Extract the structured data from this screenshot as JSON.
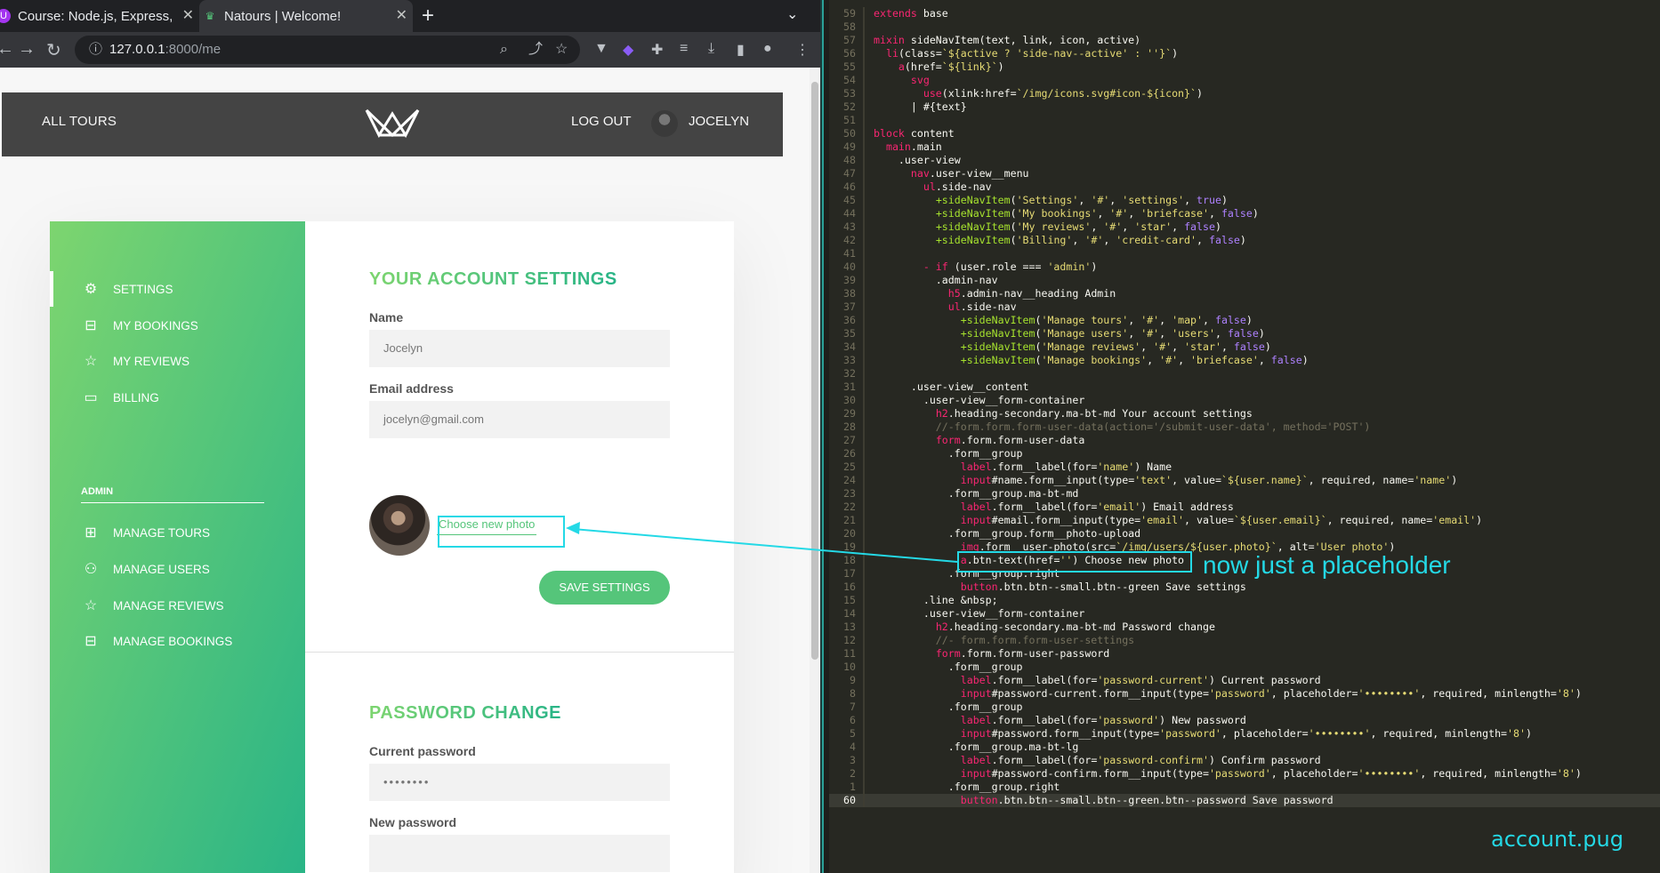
{
  "browser": {
    "tabs": [
      {
        "title": "Course: Node.js, Express,",
        "favicon": "udemy-icon"
      },
      {
        "title": "Natours | Welcome!",
        "favicon": "natours-icon"
      }
    ],
    "url_host": "127.0.0.1",
    "url_path": ":8000/me"
  },
  "site": {
    "nav_all_tours": "All tours",
    "nav_logout": "Log out",
    "user_name": "Jocelyn"
  },
  "sidebar": {
    "items": [
      {
        "label": "Settings",
        "icon": "settings-icon",
        "active": true
      },
      {
        "label": "My bookings",
        "icon": "briefcase-icon",
        "active": false
      },
      {
        "label": "My reviews",
        "icon": "star-icon",
        "active": false
      },
      {
        "label": "Billing",
        "icon": "credit-card-icon",
        "active": false
      }
    ],
    "admin_heading": "Admin",
    "admin_items": [
      {
        "label": "Manage tours",
        "icon": "map-icon"
      },
      {
        "label": "Manage users",
        "icon": "users-icon"
      },
      {
        "label": "Manage reviews",
        "icon": "star-icon"
      },
      {
        "label": "Manage bookings",
        "icon": "briefcase-icon"
      }
    ]
  },
  "settings_form": {
    "heading": "Your account settings",
    "name_label": "Name",
    "name_value": "Jocelyn",
    "email_label": "Email address",
    "email_value": "jocelyn@gmail.com",
    "choose_photo": "Choose new photo",
    "save_button": "Save settings"
  },
  "password_form": {
    "heading": "Password change",
    "current_label": "Current password",
    "current_placeholder": "••••••••",
    "new_label": "New password"
  },
  "annotation": {
    "text": "now just a placeholder"
  },
  "editor": {
    "file_label": "account.pug",
    "accent_color": "#24d9e6",
    "lines": [
      {
        "ln": "59",
        "code": "extends base"
      },
      {
        "ln": "58",
        "code": ""
      },
      {
        "ln": "57",
        "code": "mixin sideNavItem(text, link, icon, active)"
      },
      {
        "ln": "56",
        "code": "  li(class=`${active ? 'side-nav--active' : ''}`)"
      },
      {
        "ln": "55",
        "code": "    a(href=`${link}`)"
      },
      {
        "ln": "54",
        "code": "      svg"
      },
      {
        "ln": "53",
        "code": "        use(xlink:href=`/img/icons.svg#icon-${icon}`)"
      },
      {
        "ln": "52",
        "code": "      | #{text}"
      },
      {
        "ln": "51",
        "code": ""
      },
      {
        "ln": "50",
        "code": "block content"
      },
      {
        "ln": "49",
        "code": "  main.main"
      },
      {
        "ln": "48",
        "code": "    .user-view"
      },
      {
        "ln": "47",
        "code": "      nav.user-view__menu"
      },
      {
        "ln": "46",
        "code": "        ul.side-nav"
      },
      {
        "ln": "45",
        "code": "          +sideNavItem('Settings', '#', 'settings', true)"
      },
      {
        "ln": "44",
        "code": "          +sideNavItem('My bookings', '#', 'briefcase', false)"
      },
      {
        "ln": "43",
        "code": "          +sideNavItem('My reviews', '#', 'star', false)"
      },
      {
        "ln": "42",
        "code": "          +sideNavItem('Billing', '#', 'credit-card', false)"
      },
      {
        "ln": "41",
        "code": ""
      },
      {
        "ln": "40",
        "code": "        - if (user.role === 'admin')"
      },
      {
        "ln": "39",
        "code": "          .admin-nav"
      },
      {
        "ln": "38",
        "code": "            h5.admin-nav__heading Admin"
      },
      {
        "ln": "37",
        "code": "            ul.side-nav"
      },
      {
        "ln": "36",
        "code": "              +sideNavItem('Manage tours', '#', 'map', false)"
      },
      {
        "ln": "35",
        "code": "              +sideNavItem('Manage users', '#', 'users', false)"
      },
      {
        "ln": "34",
        "code": "              +sideNavItem('Manage reviews', '#', 'star', false)"
      },
      {
        "ln": "33",
        "code": "              +sideNavItem('Manage bookings', '#', 'briefcase', false)"
      },
      {
        "ln": "32",
        "code": ""
      },
      {
        "ln": "31",
        "code": "      .user-view__content"
      },
      {
        "ln": "30",
        "code": "        .user-view__form-container"
      },
      {
        "ln": "29",
        "code": "          h2.heading-secondary.ma-bt-md Your account settings"
      },
      {
        "ln": "28",
        "code": "          //-form.form.form-user-data(action='/submit-user-data', method='POST')"
      },
      {
        "ln": "27",
        "code": "          form.form.form-user-data"
      },
      {
        "ln": "26",
        "code": "            .form__group"
      },
      {
        "ln": "25",
        "code": "              label.form__label(for='name') Name"
      },
      {
        "ln": "24",
        "code": "              input#name.form__input(type='text', value=`${user.name}`, required, name='name')"
      },
      {
        "ln": "23",
        "code": "            .form__group.ma-bt-md"
      },
      {
        "ln": "22",
        "code": "              label.form__label(for='email') Email address"
      },
      {
        "ln": "21",
        "code": "              input#email.form__input(type='email', value=`${user.email}`, required, name='email')"
      },
      {
        "ln": "20",
        "code": "            .form__group.form__photo-upload"
      },
      {
        "ln": "19",
        "code": "              img.form__user-photo(src=`/img/users/${user.photo}`, alt='User photo')"
      },
      {
        "ln": "18",
        "code": "              a.btn-text(href='') Choose new photo"
      },
      {
        "ln": "17",
        "code": "            .form__group.right"
      },
      {
        "ln": "16",
        "code": "              button.btn.btn--small.btn--green Save settings"
      },
      {
        "ln": "15",
        "code": "        .line &nbsp;"
      },
      {
        "ln": "14",
        "code": "        .user-view__form-container"
      },
      {
        "ln": "13",
        "code": "          h2.heading-secondary.ma-bt-md Password change"
      },
      {
        "ln": "12",
        "code": "          //- form.form.form-user-settings"
      },
      {
        "ln": "11",
        "code": "          form.form.form-user-password"
      },
      {
        "ln": "10",
        "code": "            .form__group"
      },
      {
        "ln": "9",
        "code": "              label.form__label(for='password-current') Current password"
      },
      {
        "ln": "8",
        "code": "              input#password-current.form__input(type='password', placeholder='••••••••', required, minlength='8')"
      },
      {
        "ln": "7",
        "code": "            .form__group"
      },
      {
        "ln": "6",
        "code": "              label.form__label(for='password') New password"
      },
      {
        "ln": "5",
        "code": "              input#password.form__input(type='password', placeholder='••••••••', required, minlength='8')"
      },
      {
        "ln": "4",
        "code": "            .form__group.ma-bt-lg"
      },
      {
        "ln": "3",
        "code": "              label.form__label(for='password-confirm') Confirm password"
      },
      {
        "ln": "2",
        "code": "              input#password-confirm.form__input(type='password', placeholder='••••••••', required, minlength='8')"
      },
      {
        "ln": "1",
        "code": "            .form__group.right"
      },
      {
        "ln": "60",
        "code": "              button.btn.btn--small.btn--green.btn--password Save password",
        "current": true
      }
    ]
  }
}
